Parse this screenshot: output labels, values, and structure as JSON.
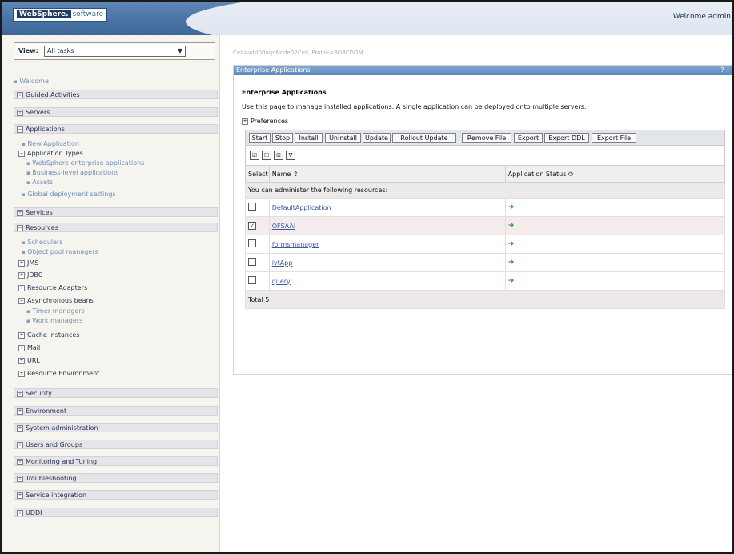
{
  "header": {
    "logo_brand": "WebSphere.",
    "logo_suffix": "software",
    "welcome": "Welcome admin"
  },
  "sidebar": {
    "view_label": "View:",
    "view_value": "All tasks",
    "welcome_link": "Welcome",
    "guided_activities": "Guided Activities",
    "servers": "Servers",
    "applications": "Applications",
    "new_application": "New Application",
    "application_types": "Application Types",
    "websphere_enterprise_apps": "WebSphere enterprise applications",
    "business_level_apps": "Business-level applications",
    "assets": "Assets",
    "global_deployment": "Global deployment settings",
    "services": "Services",
    "resources": "Resources",
    "schedulers": "Schedulers",
    "object_pool_managers": "Object pool managers",
    "jms": "JMS",
    "jdbc": "JDBC",
    "resource_adapters": "Resource Adapters",
    "asynchronous_beans": "Asynchronous beans",
    "timer_managers": "Timer managers",
    "work_managers": "Work managers",
    "cache_instances": "Cache instances",
    "mail": "Mail",
    "url": "URL",
    "resource_environment": "Resource Environment",
    "security": "Security",
    "environment": "Environment",
    "system_administration": "System administration",
    "users_and_groups": "Users and Groups",
    "monitoring_and_tuning": "Monitoring and Tuning",
    "troubleshooting": "Troubleshooting",
    "service_integration": "Service integration",
    "uddi": "UDDI"
  },
  "main": {
    "breadcrumb": "Cell=whf00aqnNode02Cell, Profile=BORCDOM",
    "portlet_title": "Enterprise Applications",
    "portlet_icons": "? –",
    "content_title": "Enterprise Applications",
    "description": "Use this page to manage installed applications. A single application can be deployed onto multiple servers.",
    "preferences": "Preferences",
    "buttons": {
      "start": "Start",
      "stop": "Stop",
      "install": "Install",
      "uninstall": "Uninstall",
      "update": "Update",
      "rollout_update": "Rollout Update",
      "remove_file": "Remove File",
      "export": "Export",
      "export_ddl": "Export DDL",
      "export_file": "Export File"
    },
    "table": {
      "col_select": "Select",
      "col_name": "Name ⇕",
      "col_status": "Application Status ⟳",
      "admin_note": "You can administer the following resources:",
      "rows": [
        {
          "name": "DefaultApplication",
          "checked": "",
          "status": "➜"
        },
        {
          "name": "OFSAAI",
          "checked": "✓",
          "status": "➜"
        },
        {
          "name": "formsmanager",
          "checked": "",
          "status": "➜"
        },
        {
          "name": "ivtApp",
          "checked": "",
          "status": "➜"
        },
        {
          "name": "query",
          "checked": "",
          "status": "➜"
        }
      ],
      "total": "Total 5"
    }
  }
}
